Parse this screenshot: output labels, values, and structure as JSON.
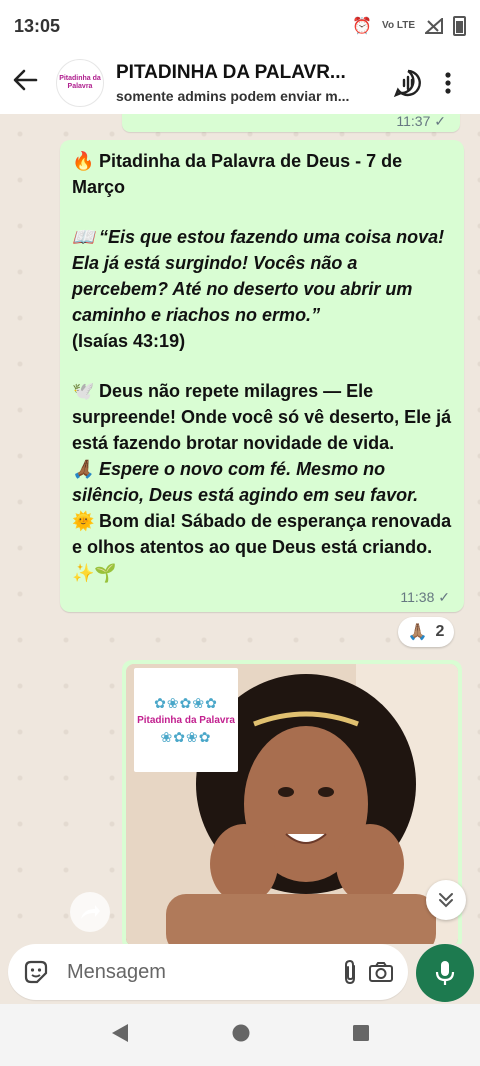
{
  "status_bar": {
    "time": "13:05",
    "network": "Vo LTE"
  },
  "header": {
    "title": "PITADINHA DA PALAVR...",
    "subtitle": "somente admins podem enviar m...",
    "avatar_text": "Pitadinha da Palavra"
  },
  "chat": {
    "prev_time": "11:37 ✓",
    "message": {
      "title_emoji": "🔥",
      "title": "Pitadinha da Palavra de Deus - 7 de Março",
      "verse_emoji": "📖",
      "verse": "“Eis que estou fazendo uma coisa nova! Ela já está surgindo! Vocês não a percebem? Até no deserto vou abrir um caminho e riachos no ermo.”",
      "reference": "(Isaías 43:19)",
      "p1_emoji": "🕊️",
      "p1": "Deus não repete milagres — Ele surpreende! Onde você só vê deserto, Ele já está fazendo brotar novidade de vida.",
      "p2_emoji": "🙏🏾",
      "p2": "Espere o novo com fé. Mesmo no silêncio, Deus está agindo em seu favor.",
      "p3_emoji": "🌞",
      "p3": "Bom dia! Sábado de esperança renovada e olhos atentos ao que Deus está criando.",
      "p3_end": "✨🌱",
      "time": "11:38 ✓"
    },
    "reaction": {
      "emoji": "🙏🏽",
      "count": "2"
    },
    "image_logo_text": "Pitadinha da Palavra"
  },
  "input": {
    "placeholder": "Mensagem"
  },
  "colors": {
    "bubble": "#d9fdd3",
    "accent": "#1d7a4f",
    "chat_bg": "#efe7de"
  }
}
